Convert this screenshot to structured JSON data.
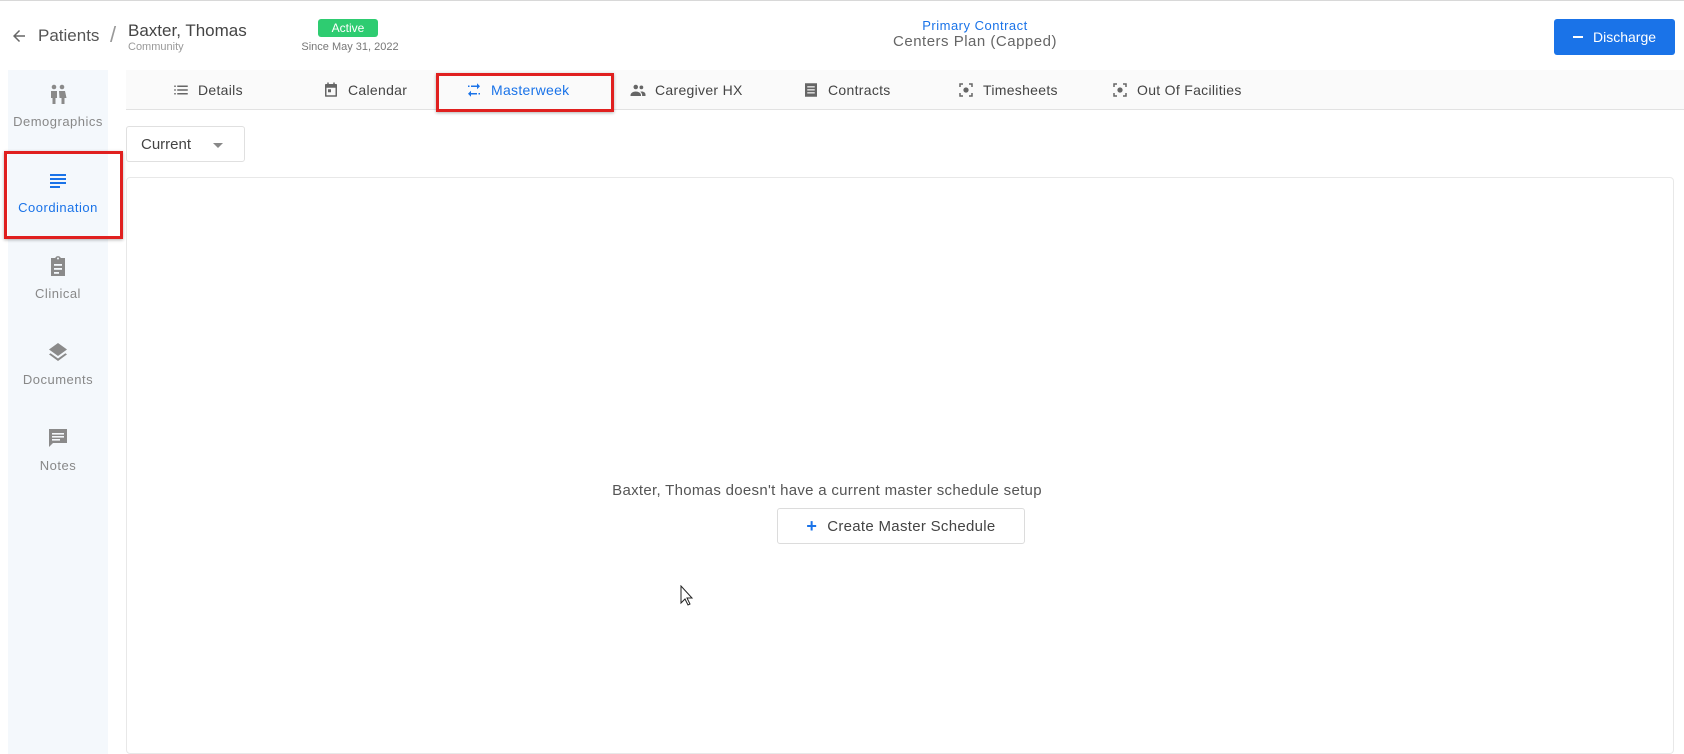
{
  "header": {
    "breadcrumb_root": "Patients",
    "breadcrumb_sep": "/",
    "patient_name": "Baxter, Thomas",
    "patient_type": "Community",
    "status": "Active",
    "status_color": "#2ecc71",
    "status_since": "Since May 31, 2022",
    "contract_label": "Primary Contract",
    "contract_value": "Centers Plan (Capped)",
    "discharge_label": "Discharge"
  },
  "sidebar": {
    "items": [
      {
        "label": "Demographics",
        "icon": "people-icon"
      },
      {
        "label": "Coordination",
        "icon": "notes-lines-icon",
        "active": true
      },
      {
        "label": "Clinical",
        "icon": "clipboard-icon"
      },
      {
        "label": "Documents",
        "icon": "layers-icon"
      },
      {
        "label": "Notes",
        "icon": "comment-icon"
      }
    ]
  },
  "tabs": [
    {
      "label": "Details",
      "icon": "list-icon"
    },
    {
      "label": "Calendar",
      "icon": "calendar-icon"
    },
    {
      "label": "Masterweek",
      "icon": "swap-icon",
      "active": true
    },
    {
      "label": "Caregiver HX",
      "icon": "group-icon"
    },
    {
      "label": "Contracts",
      "icon": "document-icon"
    },
    {
      "label": "Timesheets",
      "icon": "focus-icon"
    },
    {
      "label": "Out Of Facilities",
      "icon": "focus-icon"
    }
  ],
  "period": {
    "selected": "Current"
  },
  "main": {
    "empty_message": "Baxter, Thomas doesn't have a current master schedule setup",
    "create_label": "Create Master Schedule"
  },
  "colors": {
    "accent": "#1a73e8",
    "highlight": "#e0201f",
    "sidebar_bg": "#f4f8fc"
  }
}
